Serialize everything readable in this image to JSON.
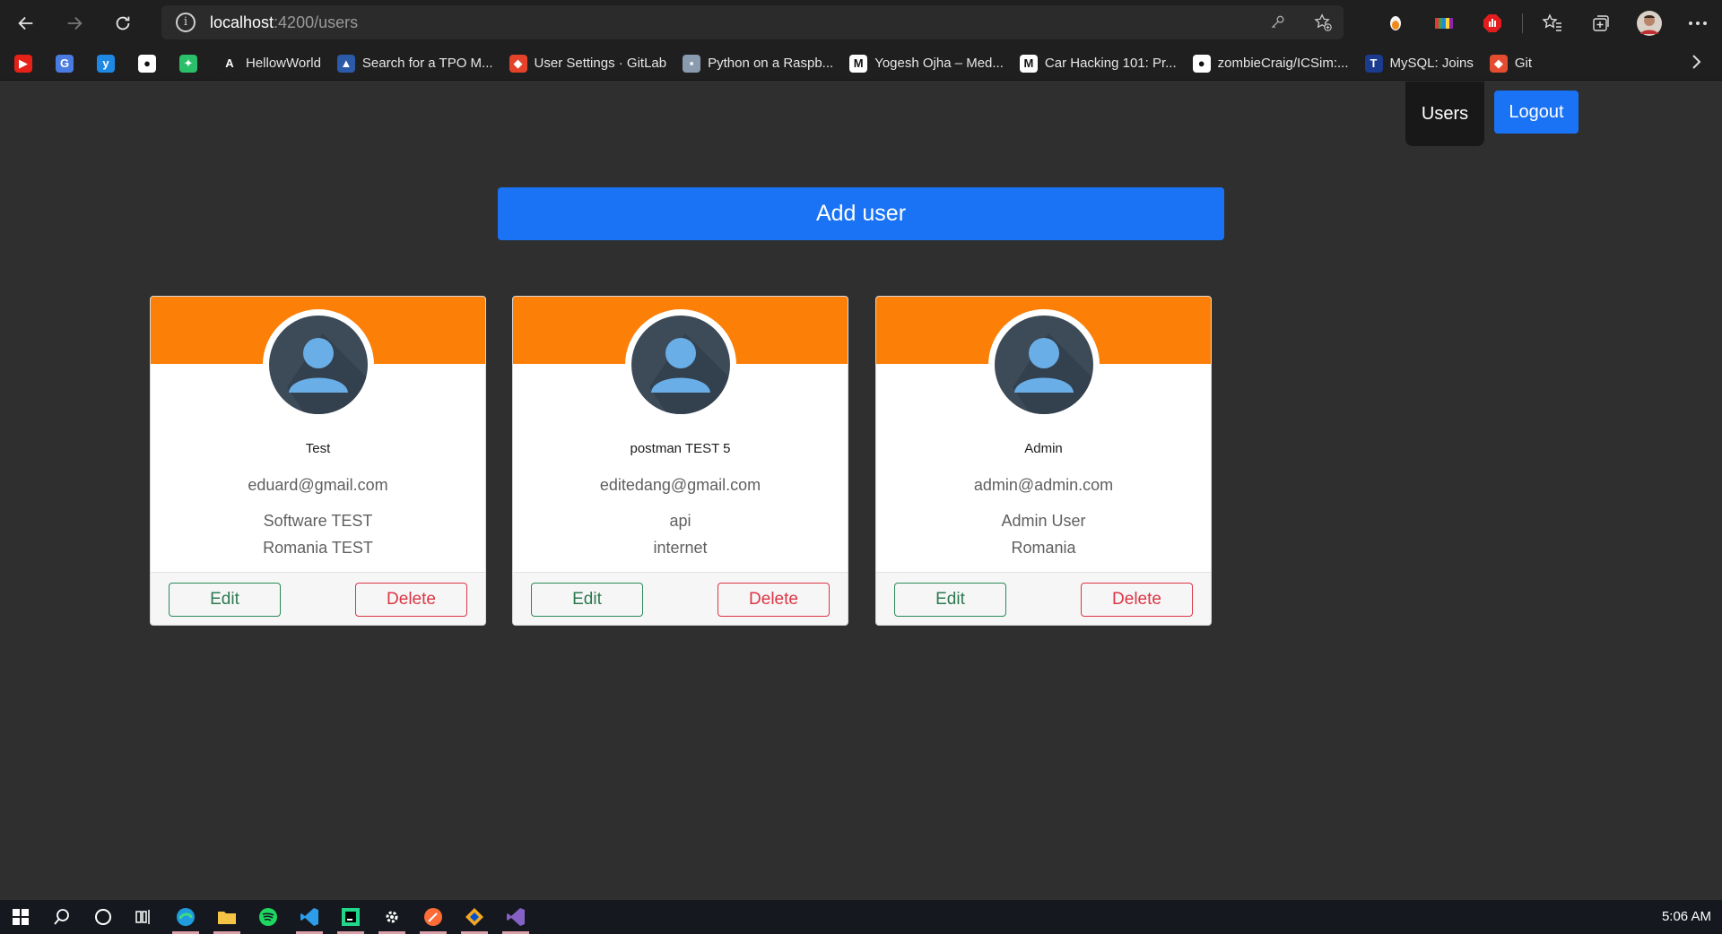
{
  "browser": {
    "url_host": "localhost",
    "url_path": ":4200/users",
    "bookmarks": [
      {
        "label": "",
        "icon": "youtube-icon",
        "color": "#e62117"
      },
      {
        "label": "",
        "icon": "translate-icon",
        "color": "#4a7be0"
      },
      {
        "label": "",
        "icon": "yammer-icon",
        "color": "#1e88e5"
      },
      {
        "label": "",
        "icon": "github-icon",
        "color": "#ffffff"
      },
      {
        "label": "",
        "icon": "leaf-icon",
        "color": "#2bbf6a"
      },
      {
        "label": "HellowWorld",
        "icon": "a-icon",
        "color": "#1f1f1f"
      },
      {
        "label": "Search for a TPO M...",
        "icon": "mountain-icon",
        "color": "#2b5aa8"
      },
      {
        "label": "User Settings · GitLab",
        "icon": "gitlab-icon",
        "color": "#e2432a"
      },
      {
        "label": "Python on a Raspb...",
        "icon": "thumbnail-icon",
        "color": "#8a9bb0"
      },
      {
        "label": "Yogesh Ojha – Med...",
        "icon": "medium-icon",
        "color": "#ffffff"
      },
      {
        "label": "Car Hacking 101: Pr...",
        "icon": "medium-icon",
        "color": "#ffffff"
      },
      {
        "label": "zombieCraig/ICSim:...",
        "icon": "github-icon",
        "color": "#ffffff"
      },
      {
        "label": "MySQL: Joins",
        "icon": "t-icon",
        "color": "#1b3b8f"
      },
      {
        "label": "Git",
        "icon": "git-icon",
        "color": "#e44c30"
      }
    ]
  },
  "nav": {
    "users_label": "Users",
    "logout_label": "Logout"
  },
  "add_user_label": "Add user",
  "users": [
    {
      "name": "Test",
      "email": "eduard@gmail.com",
      "job": "Software TEST",
      "country": "Romania TEST",
      "edit_label": "Edit",
      "delete_label": "Delete"
    },
    {
      "name": "postman TEST 5",
      "email": "editedang@gmail.com",
      "job": "api",
      "country": "internet",
      "edit_label": "Edit",
      "delete_label": "Delete"
    },
    {
      "name": "Admin",
      "email": "admin@admin.com",
      "job": "Admin User",
      "country": "Romania",
      "edit_label": "Edit",
      "delete_label": "Delete"
    }
  ],
  "taskbar": {
    "clock": "5:06 AM"
  }
}
